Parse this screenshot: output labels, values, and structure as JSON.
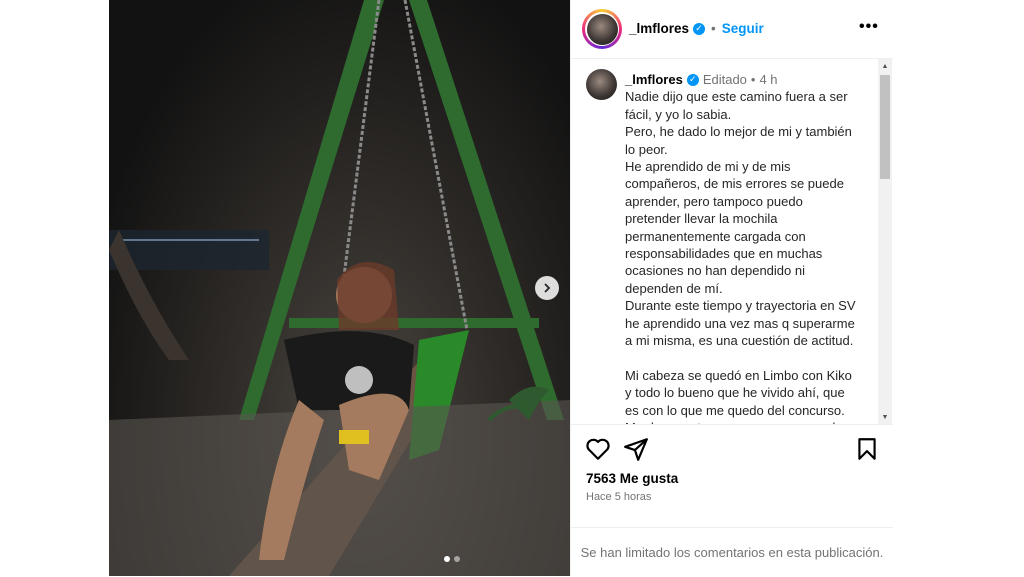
{
  "post": {
    "username": "_lmflores",
    "follow_label": "Seguir",
    "more_label": "•••",
    "verified_mark": "✓"
  },
  "caption": {
    "username": "_lmflores",
    "edited_label": "Editado",
    "time_ago": "4 h",
    "text": "Nadie dijo que este camino fuera a ser\nfácil, y yo lo sabia.\nPero, he dado lo mejor de mi y también\nlo peor.\nHe aprendido de mi y de mis\ncompañeros, de mis errores se puede\naprender, pero tampoco puedo\npretender llevar la mochila\npermanentemente cargada con\nresponsabilidades que en muchas\nocasiones no han dependido ni\ndependen de mí.\nDurante este tiempo y trayectoria en SV\nhe aprendido una vez mas q superarme\na mi misma, es una cuestión de actitud.\n\nMi cabeza se quedó en Limbo con Kiko\ny todo lo bueno que he vivido ahí, que\nes con lo que me quedo del concurso.\nMe da pena tener que expresarme de"
  },
  "stats": {
    "likes": "7563 Me gusta",
    "posted": "Hace 5 horas"
  },
  "footer": {
    "limited_notice": "Se han limitado los comentarios en esta publicación."
  },
  "icons": {
    "like": "heart-icon",
    "share": "send-icon",
    "save": "bookmark-icon",
    "next": "chevron-right-icon"
  },
  "colors": {
    "accent": "#0095f6",
    "muted": "#737373"
  }
}
